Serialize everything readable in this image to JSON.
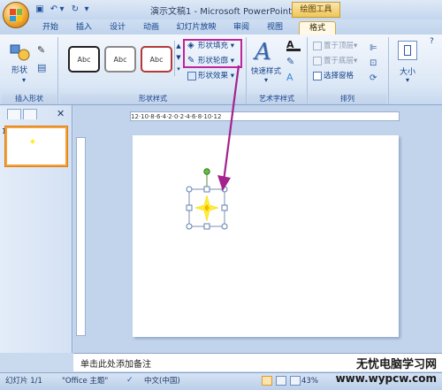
{
  "window": {
    "title": "演示文稿1 - Microsoft PowerPoint",
    "contextual_tab": "绘图工具"
  },
  "tabs": [
    "开始",
    "插入",
    "设计",
    "动画",
    "幻灯片放映",
    "审阅",
    "视图",
    "格式"
  ],
  "ribbon": {
    "insert_shapes": {
      "big_label": "形状",
      "group_label": "插入形状"
    },
    "shape_styles": {
      "styles": [
        "Abc",
        "Abc",
        "Abc"
      ],
      "fill": "形状填充",
      "outline": "形状轮廓",
      "effects": "形状效果",
      "group_label": "形状样式"
    },
    "wordart": {
      "quick_styles": "快速样式",
      "group_label": "艺术字样式"
    },
    "arrange": {
      "bring_front": "置于顶层",
      "send_back": "置于底层",
      "selection_pane": "选择窗格",
      "group_label": "排列",
      "size": "大小"
    }
  },
  "slide_pane": {
    "thumbnail_number": "1"
  },
  "ruler": {
    "text": "12·10·8·6·4·2·0·2·4·6·8·10·12"
  },
  "notes": {
    "placeholder": "单击此处添加备注"
  },
  "status": {
    "slide": "幻灯片 1/1",
    "theme": "\"Office 主题\"",
    "language": "中文(中国)",
    "zoom": "43%"
  },
  "watermark": {
    "line1": "无忧电脑学习网",
    "line2": "www.wypcw.com"
  },
  "colors": {
    "arrow": "#a3238f",
    "highlight": "#c0239a",
    "star": "#ffee33",
    "rotate_handle": "#5fc13d",
    "accent": "#f2a33a"
  }
}
